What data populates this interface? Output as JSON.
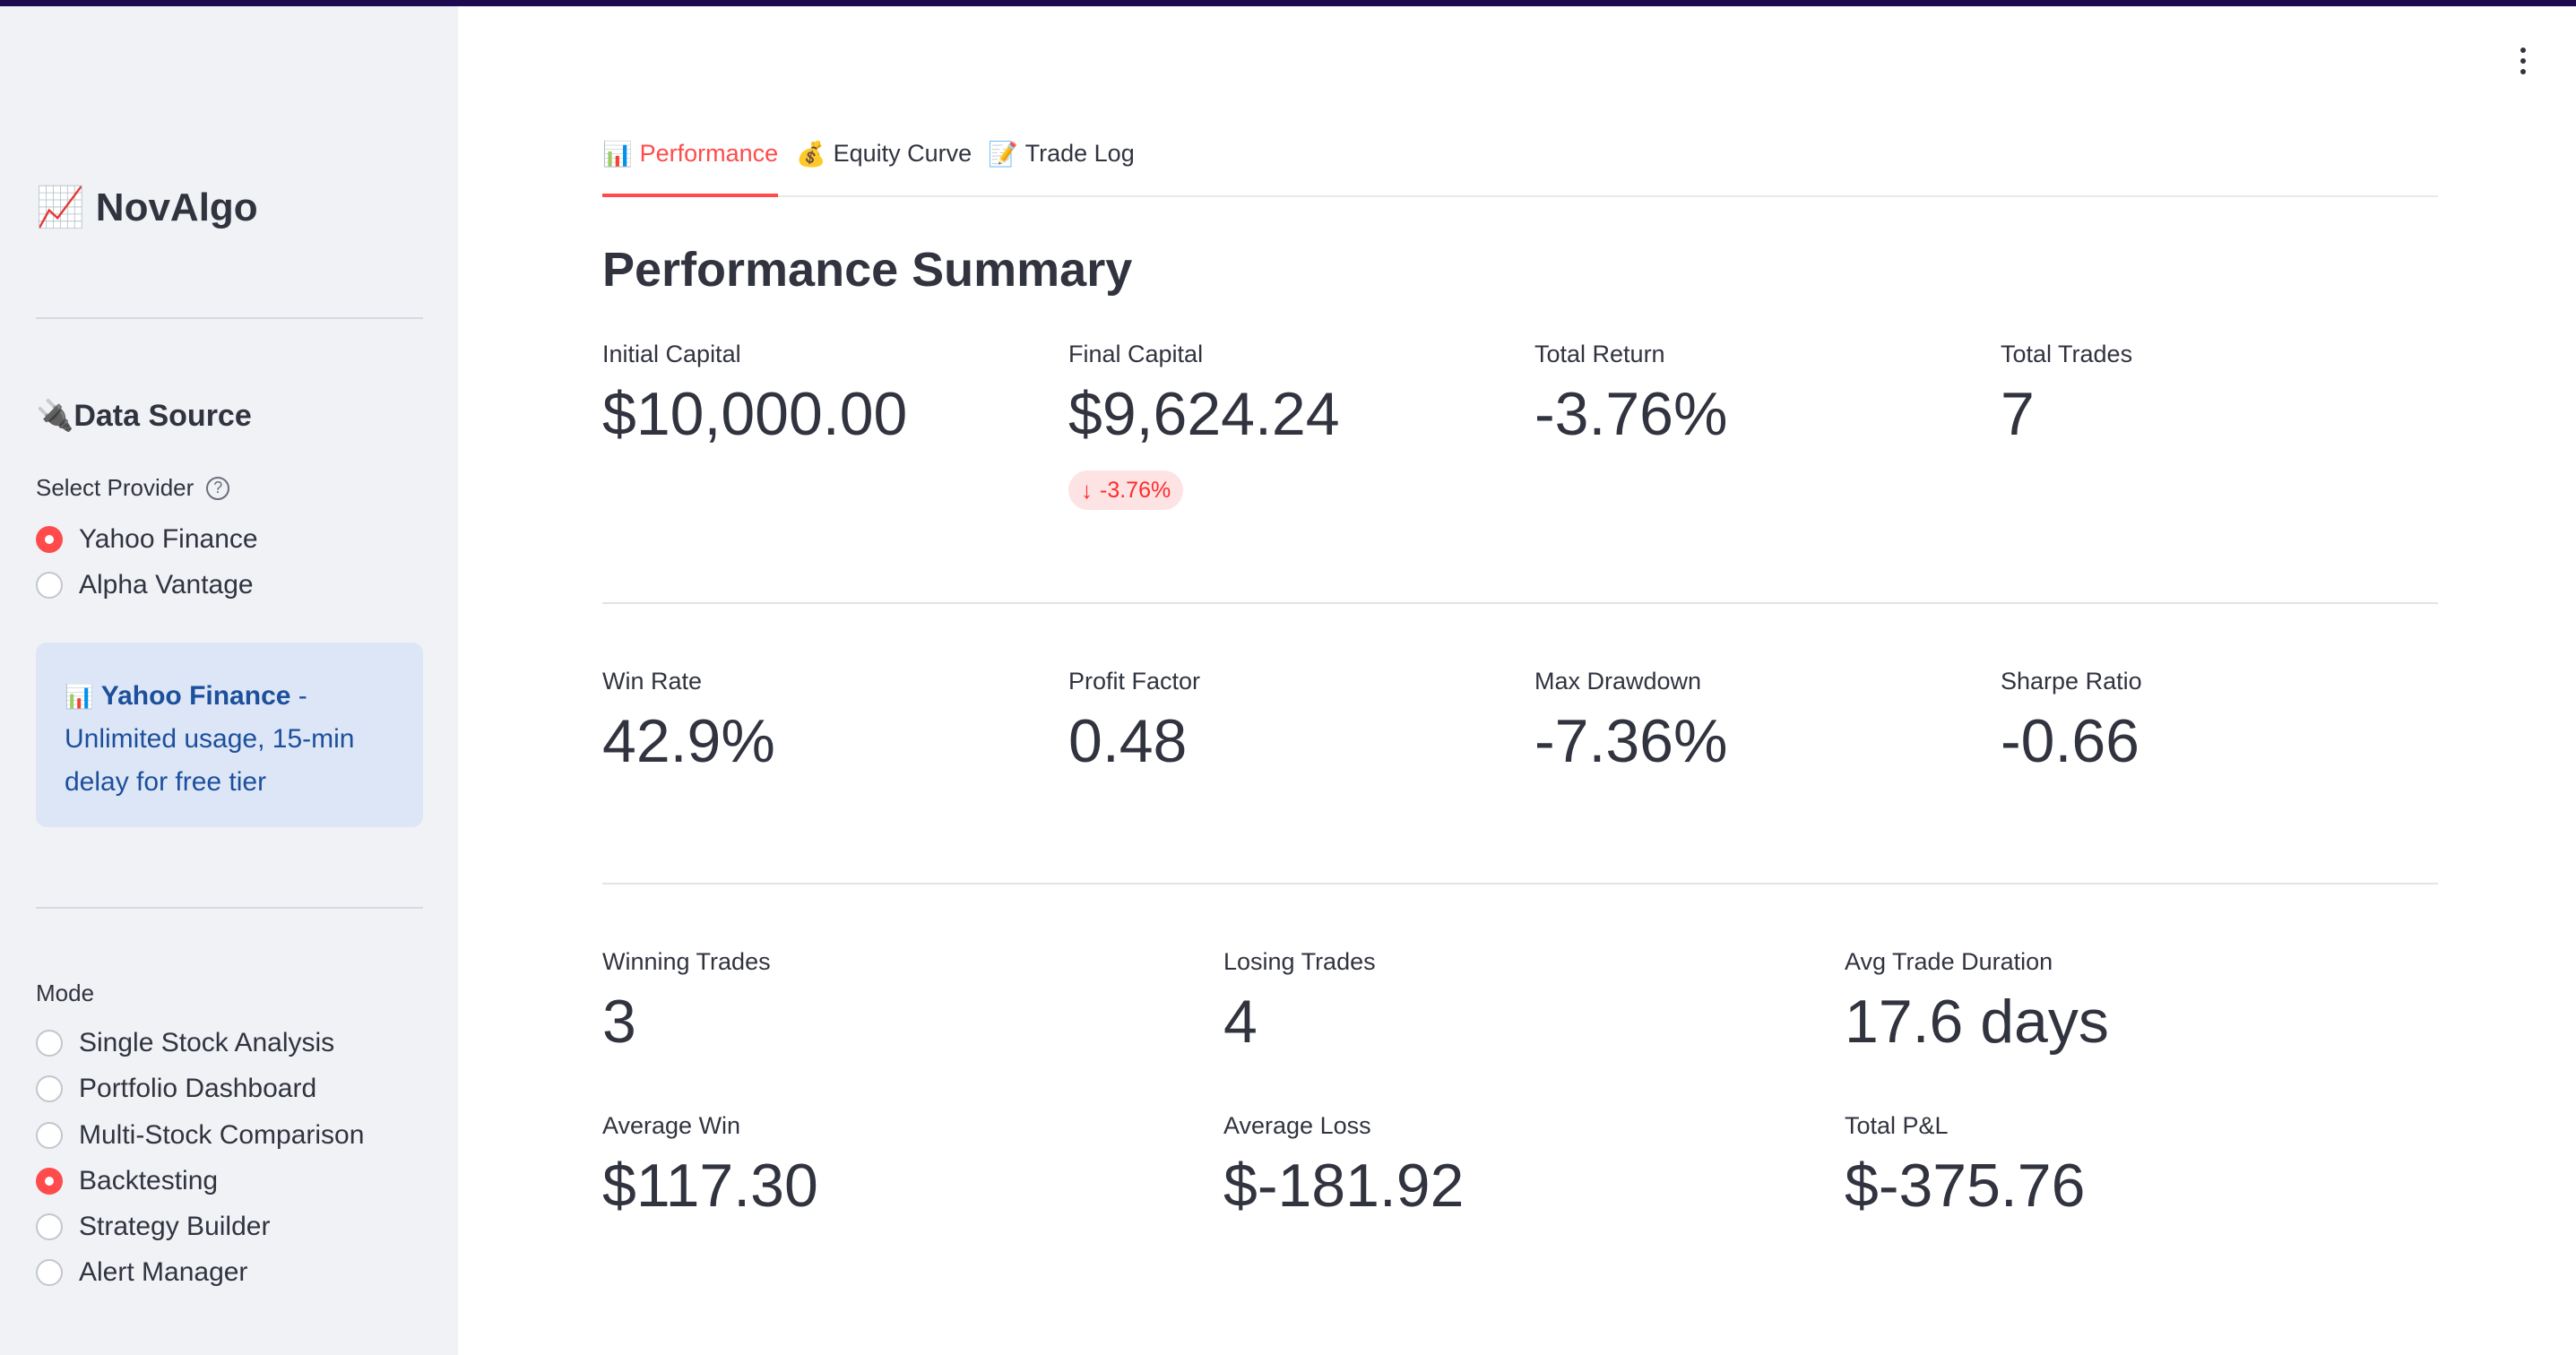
{
  "sidebar": {
    "brand_emoji": "📈",
    "brand": "NovAlgo",
    "data_source": {
      "heading_emoji": "🔌",
      "heading": "Data Source",
      "select_label": "Select Provider",
      "help_glyph": "?",
      "options": [
        "Yahoo Finance",
        "Alpha Vantage"
      ],
      "selected": "Yahoo Finance"
    },
    "info": {
      "icon": "📊",
      "title": "Yahoo Finance",
      "text": " - Unlimited usage, 15-min delay for free tier"
    },
    "mode": {
      "label": "Mode",
      "options": [
        "Single Stock Analysis",
        "Portfolio Dashboard",
        "Multi-Stock Comparison",
        "Backtesting",
        "Strategy Builder",
        "Alert Manager"
      ],
      "selected": "Backtesting"
    }
  },
  "tabs": [
    {
      "icon": "📊",
      "label": "Performance",
      "active": true
    },
    {
      "icon": "💰",
      "label": "Equity Curve",
      "active": false
    },
    {
      "icon": "📝",
      "label": "Trade Log",
      "active": false
    }
  ],
  "page_title": "Performance Summary",
  "metrics": {
    "initial_capital": {
      "label": "Initial Capital",
      "value": "$10,000.00"
    },
    "final_capital": {
      "label": "Final Capital",
      "value": "$9,624.24",
      "delta": "-3.76%",
      "delta_arrow": "↓"
    },
    "total_return": {
      "label": "Total Return",
      "value": "-3.76%"
    },
    "total_trades": {
      "label": "Total Trades",
      "value": "7"
    },
    "win_rate": {
      "label": "Win Rate",
      "value": "42.9%"
    },
    "profit_factor": {
      "label": "Profit Factor",
      "value": "0.48"
    },
    "max_drawdown": {
      "label": "Max Drawdown",
      "value": "-7.36%"
    },
    "sharpe_ratio": {
      "label": "Sharpe Ratio",
      "value": "-0.66"
    },
    "winning_trades": {
      "label": "Winning Trades",
      "value": "3"
    },
    "losing_trades": {
      "label": "Losing Trades",
      "value": "4"
    },
    "avg_trade_duration": {
      "label": "Avg Trade Duration",
      "value": "17.6 days"
    },
    "average_win": {
      "label": "Average Win",
      "value": "$117.30"
    },
    "average_loss": {
      "label": "Average Loss",
      "value": "$-181.92"
    },
    "total_pnl": {
      "label": "Total P&L",
      "value": "$-375.76"
    }
  },
  "colors": {
    "accent": "#ff4b4b",
    "sidebar_bg": "#f0f2f6",
    "info_bg": "#dde6f6",
    "info_text": "#1c4f9c",
    "topbar": "#1e0b4f",
    "delta_negative": "#ff2b2b"
  },
  "icons": [
    "chart-emoji-icon",
    "plug-icon",
    "help-icon",
    "bar-chart-icon",
    "money-bag-icon",
    "memo-icon",
    "kebab-menu-icon",
    "arrow-down-icon"
  ]
}
